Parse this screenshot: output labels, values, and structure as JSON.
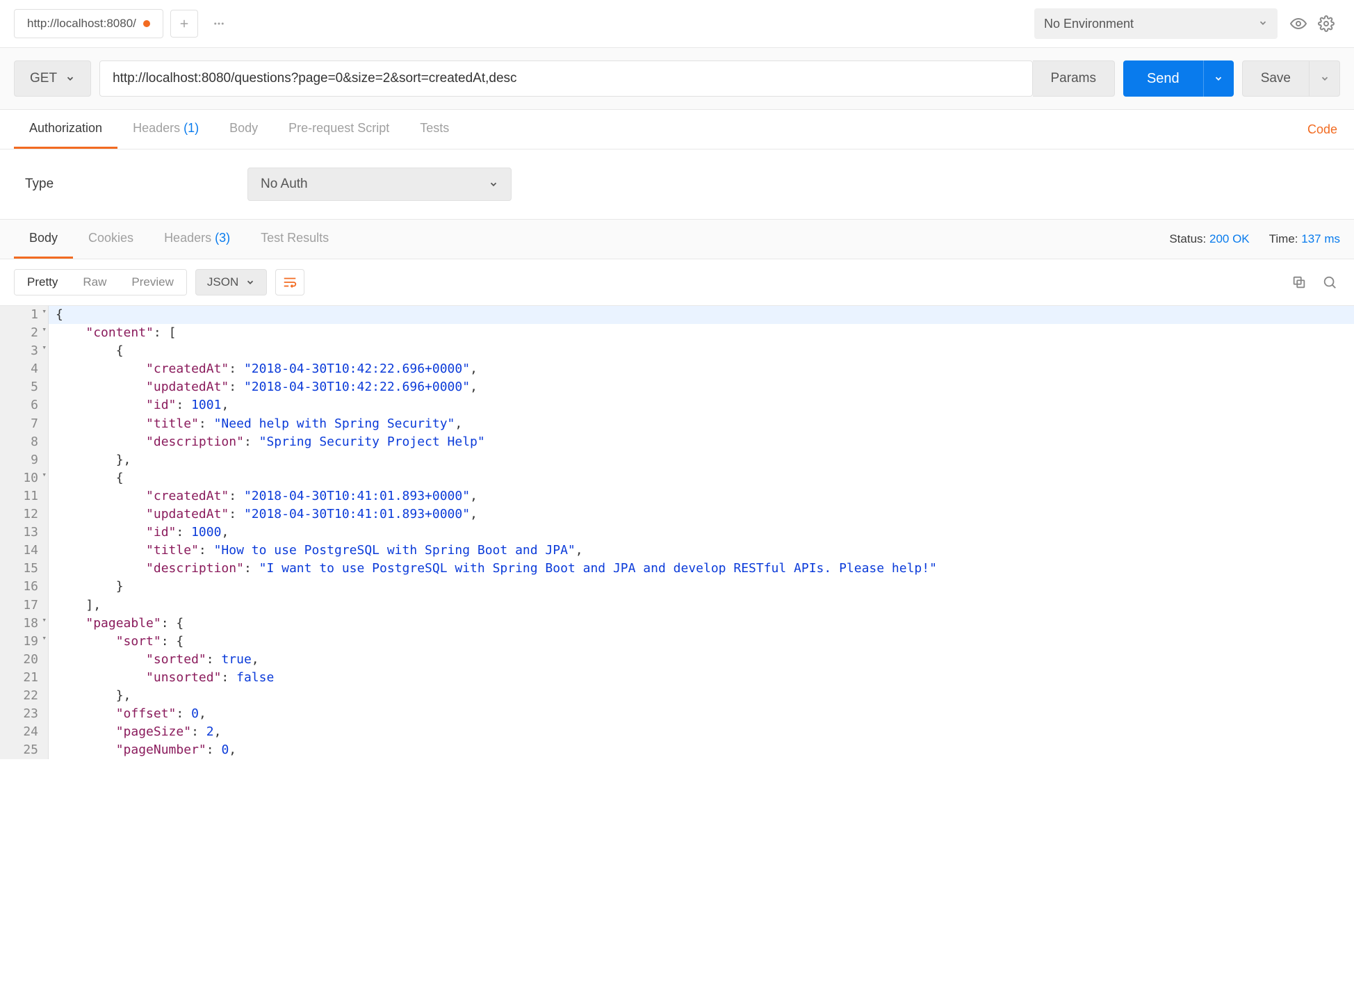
{
  "topbar": {
    "tab_title": "http://localhost:8080/",
    "env_selected": "No Environment"
  },
  "request": {
    "method": "GET",
    "url": "http://localhost:8080/questions?page=0&size=2&sort=createdAt,desc",
    "params_label": "Params",
    "send_label": "Send",
    "save_label": "Save"
  },
  "req_tabs": {
    "authorization": "Authorization",
    "headers": "Headers",
    "headers_count": "(1)",
    "body": "Body",
    "prerequest": "Pre-request Script",
    "tests": "Tests",
    "code": "Code"
  },
  "auth": {
    "type_label": "Type",
    "selected": "No Auth"
  },
  "resp_tabs": {
    "body": "Body",
    "cookies": "Cookies",
    "headers": "Headers",
    "headers_count": "(3)",
    "test_results": "Test Results"
  },
  "status": {
    "status_label": "Status:",
    "status_value": "200 OK",
    "time_label": "Time:",
    "time_value": "137 ms"
  },
  "body_toolbar": {
    "pretty": "Pretty",
    "raw": "Raw",
    "preview": "Preview",
    "format": "JSON"
  },
  "response_json": {
    "content": [
      {
        "createdAt": "2018-04-30T10:42:22.696+0000",
        "updatedAt": "2018-04-30T10:42:22.696+0000",
        "id": 1001,
        "title": "Need help with Spring Security",
        "description": "Spring Security Project Help"
      },
      {
        "createdAt": "2018-04-30T10:41:01.893+0000",
        "updatedAt": "2018-04-30T10:41:01.893+0000",
        "id": 1000,
        "title": "How to use PostgreSQL with Spring Boot and JPA",
        "description": "I want to use PostgreSQL with Spring Boot and JPA and develop RESTful APIs. Please help!"
      }
    ],
    "pageable": {
      "sort": {
        "sorted": true,
        "unsorted": false
      },
      "offset": 0,
      "pageSize": 2,
      "pageNumber": 0
    }
  },
  "code_lines": [
    {
      "n": 1,
      "fold": true,
      "indent": 0,
      "tokens": [
        {
          "t": "punc",
          "v": "{"
        }
      ]
    },
    {
      "n": 2,
      "fold": true,
      "indent": 1,
      "tokens": [
        {
          "t": "key",
          "v": "\"content\""
        },
        {
          "t": "punc",
          "v": ": ["
        }
      ]
    },
    {
      "n": 3,
      "fold": true,
      "indent": 2,
      "tokens": [
        {
          "t": "punc",
          "v": "{"
        }
      ]
    },
    {
      "n": 4,
      "indent": 3,
      "tokens": [
        {
          "t": "key",
          "v": "\"createdAt\""
        },
        {
          "t": "punc",
          "v": ": "
        },
        {
          "t": "str",
          "v": "\"2018-04-30T10:42:22.696+0000\""
        },
        {
          "t": "punc",
          "v": ","
        }
      ]
    },
    {
      "n": 5,
      "indent": 3,
      "tokens": [
        {
          "t": "key",
          "v": "\"updatedAt\""
        },
        {
          "t": "punc",
          "v": ": "
        },
        {
          "t": "str",
          "v": "\"2018-04-30T10:42:22.696+0000\""
        },
        {
          "t": "punc",
          "v": ","
        }
      ]
    },
    {
      "n": 6,
      "indent": 3,
      "tokens": [
        {
          "t": "key",
          "v": "\"id\""
        },
        {
          "t": "punc",
          "v": ": "
        },
        {
          "t": "num",
          "v": "1001"
        },
        {
          "t": "punc",
          "v": ","
        }
      ]
    },
    {
      "n": 7,
      "indent": 3,
      "tokens": [
        {
          "t": "key",
          "v": "\"title\""
        },
        {
          "t": "punc",
          "v": ": "
        },
        {
          "t": "str",
          "v": "\"Need help with Spring Security\""
        },
        {
          "t": "punc",
          "v": ","
        }
      ]
    },
    {
      "n": 8,
      "indent": 3,
      "tokens": [
        {
          "t": "key",
          "v": "\"description\""
        },
        {
          "t": "punc",
          "v": ": "
        },
        {
          "t": "str",
          "v": "\"Spring Security Project Help\""
        }
      ]
    },
    {
      "n": 9,
      "indent": 2,
      "tokens": [
        {
          "t": "punc",
          "v": "},"
        }
      ]
    },
    {
      "n": 10,
      "fold": true,
      "indent": 2,
      "tokens": [
        {
          "t": "punc",
          "v": "{"
        }
      ]
    },
    {
      "n": 11,
      "indent": 3,
      "tokens": [
        {
          "t": "key",
          "v": "\"createdAt\""
        },
        {
          "t": "punc",
          "v": ": "
        },
        {
          "t": "str",
          "v": "\"2018-04-30T10:41:01.893+0000\""
        },
        {
          "t": "punc",
          "v": ","
        }
      ]
    },
    {
      "n": 12,
      "indent": 3,
      "tokens": [
        {
          "t": "key",
          "v": "\"updatedAt\""
        },
        {
          "t": "punc",
          "v": ": "
        },
        {
          "t": "str",
          "v": "\"2018-04-30T10:41:01.893+0000\""
        },
        {
          "t": "punc",
          "v": ","
        }
      ]
    },
    {
      "n": 13,
      "indent": 3,
      "tokens": [
        {
          "t": "key",
          "v": "\"id\""
        },
        {
          "t": "punc",
          "v": ": "
        },
        {
          "t": "num",
          "v": "1000"
        },
        {
          "t": "punc",
          "v": ","
        }
      ]
    },
    {
      "n": 14,
      "indent": 3,
      "tokens": [
        {
          "t": "key",
          "v": "\"title\""
        },
        {
          "t": "punc",
          "v": ": "
        },
        {
          "t": "str",
          "v": "\"How to use PostgreSQL with Spring Boot and JPA\""
        },
        {
          "t": "punc",
          "v": ","
        }
      ]
    },
    {
      "n": 15,
      "indent": 3,
      "tokens": [
        {
          "t": "key",
          "v": "\"description\""
        },
        {
          "t": "punc",
          "v": ": "
        },
        {
          "t": "str",
          "v": "\"I want to use PostgreSQL with Spring Boot and JPA and develop RESTful APIs. Please help!\""
        }
      ]
    },
    {
      "n": 16,
      "indent": 2,
      "tokens": [
        {
          "t": "punc",
          "v": "}"
        }
      ]
    },
    {
      "n": 17,
      "indent": 1,
      "tokens": [
        {
          "t": "punc",
          "v": "],"
        }
      ]
    },
    {
      "n": 18,
      "fold": true,
      "indent": 1,
      "tokens": [
        {
          "t": "key",
          "v": "\"pageable\""
        },
        {
          "t": "punc",
          "v": ": {"
        }
      ]
    },
    {
      "n": 19,
      "fold": true,
      "indent": 2,
      "tokens": [
        {
          "t": "key",
          "v": "\"sort\""
        },
        {
          "t": "punc",
          "v": ": {"
        }
      ]
    },
    {
      "n": 20,
      "indent": 3,
      "tokens": [
        {
          "t": "key",
          "v": "\"sorted\""
        },
        {
          "t": "punc",
          "v": ": "
        },
        {
          "t": "bool",
          "v": "true"
        },
        {
          "t": "punc",
          "v": ","
        }
      ]
    },
    {
      "n": 21,
      "indent": 3,
      "tokens": [
        {
          "t": "key",
          "v": "\"unsorted\""
        },
        {
          "t": "punc",
          "v": ": "
        },
        {
          "t": "bool",
          "v": "false"
        }
      ]
    },
    {
      "n": 22,
      "indent": 2,
      "tokens": [
        {
          "t": "punc",
          "v": "},"
        }
      ]
    },
    {
      "n": 23,
      "indent": 2,
      "tokens": [
        {
          "t": "key",
          "v": "\"offset\""
        },
        {
          "t": "punc",
          "v": ": "
        },
        {
          "t": "num",
          "v": "0"
        },
        {
          "t": "punc",
          "v": ","
        }
      ]
    },
    {
      "n": 24,
      "indent": 2,
      "tokens": [
        {
          "t": "key",
          "v": "\"pageSize\""
        },
        {
          "t": "punc",
          "v": ": "
        },
        {
          "t": "num",
          "v": "2"
        },
        {
          "t": "punc",
          "v": ","
        }
      ]
    },
    {
      "n": 25,
      "indent": 2,
      "tokens": [
        {
          "t": "key",
          "v": "\"pageNumber\""
        },
        {
          "t": "punc",
          "v": ": "
        },
        {
          "t": "num",
          "v": "0"
        },
        {
          "t": "punc",
          "v": ","
        }
      ]
    }
  ]
}
